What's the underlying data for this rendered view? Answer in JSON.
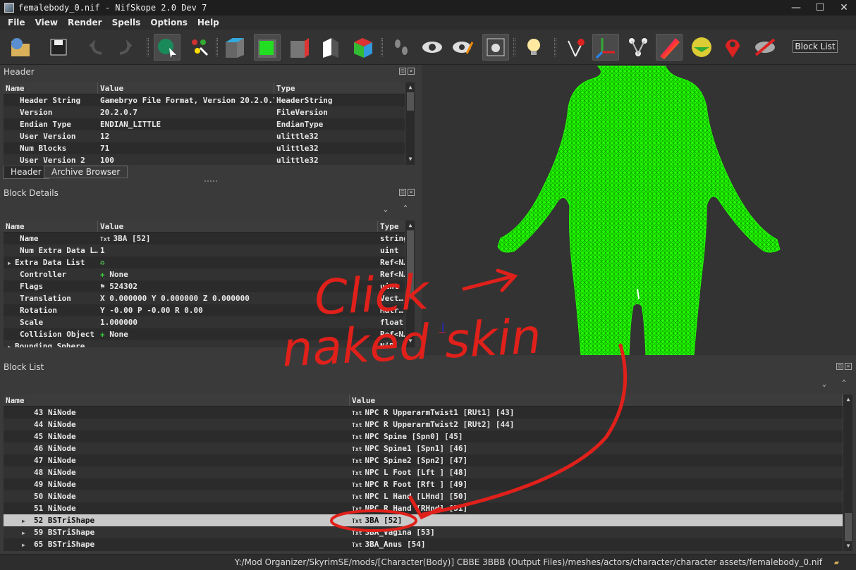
{
  "window": {
    "title": "femalebody_0.nif - NifSkope 2.0 Dev 7",
    "minimize": "—",
    "maximize": "☐",
    "close": "✕"
  },
  "menu": [
    "File",
    "View",
    "Render",
    "Spells",
    "Options",
    "Help"
  ],
  "toolbar": {
    "icons": [
      "load-icon",
      "save-icon",
      "undo-icon",
      "redo-icon",
      "select-object-icon",
      "select-vertex-icon",
      "view-flat-icon",
      "view-top-icon",
      "view-front-icon",
      "view-side-icon",
      "view-walk-icon",
      "view-user-icon",
      "eye-icon",
      "eye-pick-icon",
      "camera-icon",
      "light-icon",
      "pointer-icon",
      "axes-icon",
      "nodes-icon",
      "texture-icon",
      "constraints-icon",
      "marker-icon",
      "hide-icon"
    ],
    "block_list_label": "Block List"
  },
  "header_panel": {
    "title": "Header",
    "columns": [
      "Name",
      "Value",
      "Type"
    ],
    "rows": [
      {
        "name": "Header String",
        "value": "Gamebryo File Format, Version 20.2.0.7",
        "type": "HeaderString"
      },
      {
        "name": "Version",
        "value": "20.2.0.7",
        "type": "FileVersion"
      },
      {
        "name": "Endian Type",
        "value": "ENDIAN_LITTLE",
        "type": "EndianType"
      },
      {
        "name": "User Version",
        "value": "12",
        "type": "ulittle32"
      },
      {
        "name": "Num Blocks",
        "value": "71",
        "type": "ulittle32"
      },
      {
        "name": "User Version 2",
        "value": "100",
        "type": "ulittle32"
      }
    ],
    "tabs": [
      "Header",
      "Archive Browser"
    ]
  },
  "block_details": {
    "title": "Block Details",
    "columns": [
      "Name",
      "Value",
      "Type"
    ],
    "rows": [
      {
        "name": "Name",
        "value": "3BA [52]",
        "type": "string",
        "icon": "txt"
      },
      {
        "name": "Num Extra Data L…",
        "value": "1",
        "type": "uint"
      },
      {
        "name": "Extra Data List",
        "value": "",
        "type": "Ref<N…",
        "icon": "refresh",
        "expandable": true
      },
      {
        "name": "Controller",
        "value": "None",
        "type": "Ref<N…",
        "icon": "plus"
      },
      {
        "name": "Flags",
        "value": "524302",
        "type": "uint",
        "icon": "flag"
      },
      {
        "name": "Translation",
        "value": "X 0.000000 Y 0.000000 Z 0.000000",
        "type": "Vect…"
      },
      {
        "name": "Rotation",
        "value": "Y -0.00 P -0.00 R 0.00",
        "type": "Matr…"
      },
      {
        "name": "Scale",
        "value": "1.000000",
        "type": "float"
      },
      {
        "name": "Collision Object",
        "value": "None",
        "type": "Ref<N…",
        "icon": "plus"
      },
      {
        "name": "Bounding Sphere",
        "value": "",
        "type": "NiB…",
        "expandable": true
      }
    ]
  },
  "block_list": {
    "title": "Block List",
    "columns": [
      "Name",
      "Value"
    ],
    "rows": [
      {
        "name": "43 NiNode",
        "value": "NPC R UpperarmTwist1 [RUt1] [43]"
      },
      {
        "name": "44 NiNode",
        "value": "NPC R UpperarmTwist2 [RUt2] [44]"
      },
      {
        "name": "45 NiNode",
        "value": "NPC Spine [Spn0] [45]"
      },
      {
        "name": "46 NiNode",
        "value": "NPC Spine1 [Spn1] [46]"
      },
      {
        "name": "47 NiNode",
        "value": "NPC Spine2 [Spn2] [47]"
      },
      {
        "name": "48 NiNode",
        "value": "NPC L Foot [Lft ] [48]"
      },
      {
        "name": "49 NiNode",
        "value": "NPC R Foot [Rft ] [49]"
      },
      {
        "name": "50 NiNode",
        "value": "NPC L Hand [LHnd] [50]"
      },
      {
        "name": "51 NiNode",
        "value": "NPC R Hand [RHnd] [51]"
      },
      {
        "name": "52 BSTriShape",
        "value": "3BA [52]",
        "selected": true,
        "expandable": true
      },
      {
        "name": "59 BSTriShape",
        "value": "3BA_Vagina [53]",
        "expandable": true
      },
      {
        "name": "65 BSTriShape",
        "value": "3BA_Anus [54]",
        "expandable": true
      }
    ]
  },
  "status": {
    "path": "Y:/Mod Organizer/SkyrimSE/mods/[Character(Body)] CBBE 3BBB (Output Files)/meshes/actors/character/character assets/femalebody_0.nif"
  },
  "annotation": {
    "line1": "Click",
    "line2": "naked skin",
    "color": "#e0201a"
  },
  "viewport": {
    "background": "#333333",
    "mesh_color": "#22ff00"
  }
}
